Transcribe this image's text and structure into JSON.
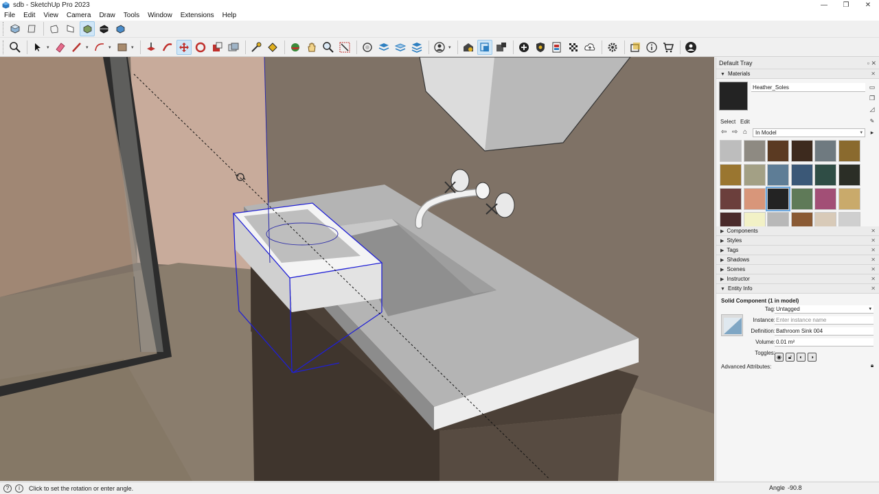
{
  "window": {
    "title": "sdb - SketchUp Pro 2023",
    "controls": [
      "—",
      "❐",
      "✕"
    ]
  },
  "menu": [
    "File",
    "Edit",
    "View",
    "Camera",
    "Draw",
    "Tools",
    "Window",
    "Extensions",
    "Help"
  ],
  "tray": {
    "title": "Default Tray",
    "materials": {
      "heading": "Materials",
      "current_name": "Heather_Soles",
      "current_color": "#232323",
      "tab_select": "Select",
      "tab_edit": "Edit",
      "library": "In Model",
      "swatches": [
        "#bdbdbd",
        "#8e8a82",
        "#5b3a22",
        "#3d2a1e",
        "#6f7a80",
        "#8a6a2e",
        "#9a7630",
        "#a3a085",
        "#5e7d96",
        "#3b5877",
        "#2f4d45",
        "#2b2e26",
        "#6b3f3c",
        "#d8967a",
        "#232323",
        "#5f7a58",
        "#a24f76",
        "#c9aa6b",
        "#4a2a2a",
        "#f2f1c6",
        "#b8b8b8",
        "#8a5a34",
        "#d8cab8",
        "#cfcfcf"
      ],
      "selected_swatch": 14
    },
    "panels": [
      "Components",
      "Styles",
      "Tags",
      "Shadows",
      "Scenes",
      "Instructor",
      "Entity Info"
    ],
    "entity_info": {
      "title": "Solid Component (1 in model)",
      "tag_label": "Tag:",
      "tag_value": "Untagged",
      "instance_label": "Instance:",
      "instance_placeholder": "Enter instance name",
      "definition_label": "Definition:",
      "definition_value": "Bathroom Sink 004",
      "volume_label": "Volume:",
      "volume_value": "0.01 m²",
      "toggles_label": "Toggles:",
      "advanced_label": "Advanced Attributes:"
    }
  },
  "status": {
    "text": "Click to set the rotation or enter angle.",
    "measure_label": "Angle",
    "measure_value": "-90.8"
  }
}
